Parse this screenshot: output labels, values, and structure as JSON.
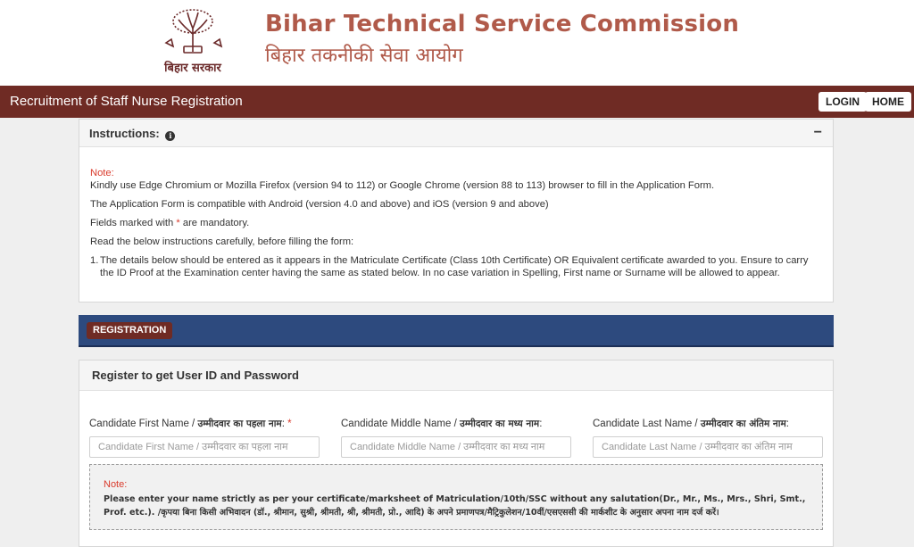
{
  "header": {
    "title_en": "Bihar Technical Service Commission",
    "title_hi": "बिहार तकनीकी सेवा आयोग",
    "emblem_caption": "बिहार सरकार"
  },
  "topbar": {
    "title": "Recruitment of Staff Nurse Registration",
    "login_label": "LOGIN",
    "home_label": "HOME"
  },
  "instructions": {
    "heading": "Instructions:",
    "collapse_symbol": "−",
    "note_label": "Note:",
    "line1": "Kindly use Edge Chromium or Mozilla Firefox (version 94 to 112) or Google Chrome (version 88 to 113) browser to fill in the Application Form.",
    "line2": "The Application Form is compatible with Android (version 4.0 and above) and iOS (version 9 and above)",
    "line3_pre": "Fields marked with",
    "line3_star": "*",
    "line3_post": "are mandatory.",
    "line4": "Read the below instructions carefully, before filling the form:",
    "item1_num": "1.",
    "item1": "The details below should be entered as it appears in the Matriculate Certificate (Class 10th Certificate) OR Equivalent certificate awarded to you. Ensure to carry the ID Proof at the Examination center having the same as stated below. In no case variation in Spelling, First name or Surname will be allowed to appear."
  },
  "registration_tab": "REGISTRATION",
  "register": {
    "heading": "Register to get User ID and Password",
    "first_name": {
      "label": "Candidate First Name / ",
      "label_hi": "उम्मीदवार का पहला नाम",
      "suffix": ":",
      "required": "*",
      "placeholder": "Candidate First Name / उम्मीदवार का पहला नाम"
    },
    "middle_name": {
      "label": "Candidate Middle Name / ",
      "label_hi": "उम्मीदवार का मध्य नाम",
      "suffix": ":",
      "placeholder": "Candidate Middle Name / उम्मीदवार का मध्य नाम"
    },
    "last_name": {
      "label": "Candidate Last Name / ",
      "label_hi": "उम्मीदवार का अंतिम नाम",
      "suffix": ":",
      "placeholder": "Candidate Last Name / उम्मीदवार का अंतिम नाम"
    },
    "note_label": "Note:",
    "note_text": "Please enter your name strictly as per your certificate/marksheet of Matriculation/10th/SSC without any salutation(Dr., Mr., Ms., Mrs., Shri, Smt., Prof. etc.). /कृपया बिना किसी अभिवादन (डॉ., श्रीमान, सुश्री, श्रीमती, श्री, श्रीमती, प्रो., आदि) के अपने प्रमाणपत्र/मैट्रिकुलेशन/10वीं/एसएससी की मार्कशीट के अनुसार अपना नाम दर्ज करें।"
  },
  "colors": {
    "brand_maroon": "#6f2b24",
    "title_rust": "#b05a4a",
    "registration_blue": "#2d4a7e",
    "required_red": "#d93a2b"
  }
}
